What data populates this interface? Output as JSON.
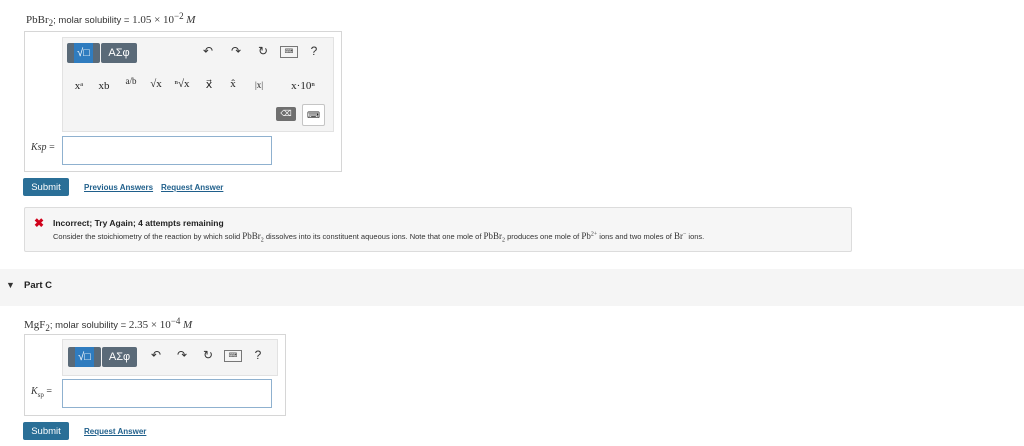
{
  "partB": {
    "prompt_compound": "PbBr",
    "prompt_compound_sub": "2",
    "prompt_label": "; molar solubility = ",
    "prompt_value": "1.05 × 10",
    "prompt_exp": "−2",
    "prompt_unit": "M",
    "toolbar": {
      "template_label": "√□",
      "greek_label": "ΑΣφ",
      "undo_icon": "undo-icon",
      "redo_icon": "redo-icon",
      "reset_icon": "reset-icon",
      "keyboard_icon": "keyboard-icon",
      "help_label": "?"
    },
    "palette": [
      "xᵃ",
      "xb",
      "a/b",
      "√x",
      "ⁿ√x",
      "x⃗",
      "x̂",
      "|x|",
      "x·10ⁿ"
    ],
    "ksp_label": "Ksp",
    "ksp_sub": "sp",
    "equals": "=",
    "input_value": "",
    "submit_label": "Submit",
    "previous_answers": "Previous Answers",
    "request_answer": "Request Answer"
  },
  "feedback": {
    "status": "Incorrect; Try Again; 4 attempts remaining",
    "message_start": "Consider the stoichiometry of the reaction by which solid ",
    "message_compound": "PbBr",
    "message_compound_sub": "2",
    "message_mid": " dissolves into its constituent aqueous ions. Note that one mole of ",
    "message_compound2": "PbBr",
    "message_compound2_sub": "2",
    "message_mid2": " produces one mole of ",
    "message_ion1": "Pb",
    "message_ion1_sup": "2+",
    "message_mid3": " ions and two moles of ",
    "message_ion2": "Br",
    "message_ion2_sup": "−",
    "message_end": " ions."
  },
  "partC": {
    "title": "Part C",
    "prompt_compound": "MgF",
    "prompt_compound_sub": "2",
    "prompt_label": "; molar solubility = ",
    "prompt_value": "2.35 × 10",
    "prompt_exp": "−4",
    "prompt_unit": "M",
    "toolbar": {
      "template_label": "√□",
      "greek_label": "ΑΣφ",
      "help_label": "?"
    },
    "ksp_label": "K",
    "ksp_sub": "sp",
    "equals": "=",
    "input_value": "",
    "submit_label": "Submit",
    "request_answer": "Request Answer"
  },
  "colors": {
    "accent": "#2a6f97",
    "error": "#d0021b",
    "template_blue": "#2f7cbf"
  }
}
